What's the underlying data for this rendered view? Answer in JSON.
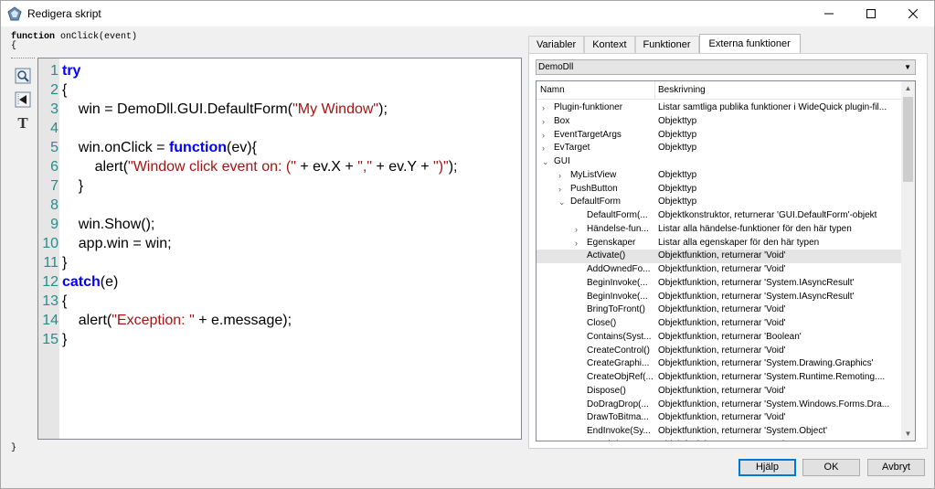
{
  "window": {
    "title": "Redigera skript",
    "minimize": "—",
    "maximize": "☐",
    "close": "✕"
  },
  "signature": {
    "keyword": "function",
    "rest": " onClick(event)",
    "open_brace": "{",
    "close_brace": "}"
  },
  "toolbar": {
    "text_tool": "T"
  },
  "code_lines": [
    {
      "n": "1",
      "parts": [
        {
          "t": "try",
          "c": "kwd"
        }
      ]
    },
    {
      "n": "2",
      "parts": [
        {
          "t": "{",
          "c": ""
        }
      ]
    },
    {
      "n": "3",
      "parts": [
        {
          "t": "    win = DemoDll.GUI.DefaultForm(",
          "c": ""
        },
        {
          "t": "\"My Window\"",
          "c": "str"
        },
        {
          "t": ");",
          "c": ""
        }
      ]
    },
    {
      "n": "4",
      "parts": []
    },
    {
      "n": "5",
      "parts": [
        {
          "t": "    win.onClick = ",
          "c": ""
        },
        {
          "t": "function",
          "c": "kwd"
        },
        {
          "t": "(ev){",
          "c": ""
        }
      ]
    },
    {
      "n": "6",
      "parts": [
        {
          "t": "        alert(",
          "c": ""
        },
        {
          "t": "\"Window click event on: (\"",
          "c": "str"
        },
        {
          "t": " + ev.X + ",
          "c": ""
        },
        {
          "t": "\",\"",
          "c": "str"
        },
        {
          "t": " + ev.Y + ",
          "c": ""
        },
        {
          "t": "\")\"",
          "c": "str"
        },
        {
          "t": ");",
          "c": ""
        }
      ]
    },
    {
      "n": "7",
      "parts": [
        {
          "t": "    }",
          "c": ""
        }
      ]
    },
    {
      "n": "8",
      "parts": []
    },
    {
      "n": "9",
      "parts": [
        {
          "t": "    win.Show();",
          "c": ""
        }
      ]
    },
    {
      "n": "10",
      "parts": [
        {
          "t": "    app.win = win;",
          "c": ""
        }
      ]
    },
    {
      "n": "11",
      "parts": [
        {
          "t": "}",
          "c": ""
        }
      ]
    },
    {
      "n": "12",
      "parts": [
        {
          "t": "catch",
          "c": "kwd"
        },
        {
          "t": "(e)",
          "c": ""
        }
      ]
    },
    {
      "n": "13",
      "parts": [
        {
          "t": "{",
          "c": ""
        }
      ]
    },
    {
      "n": "14",
      "parts": [
        {
          "t": "    alert(",
          "c": ""
        },
        {
          "t": "\"Exception: \"",
          "c": "str"
        },
        {
          "t": " + e.message);",
          "c": ""
        }
      ]
    },
    {
      "n": "15",
      "parts": [
        {
          "t": "}",
          "c": ""
        }
      ]
    }
  ],
  "tabs": [
    {
      "label": "Variabler",
      "active": false
    },
    {
      "label": "Kontext",
      "active": false
    },
    {
      "label": "Funktioner",
      "active": false
    },
    {
      "label": "Externa funktioner",
      "active": true
    }
  ],
  "dropdown": {
    "value": "DemoDll"
  },
  "listview": {
    "col_name": "Namn",
    "col_desc": "Beskrivning",
    "rows": [
      {
        "level": 0,
        "exp": "›",
        "name": "Plugin-funktioner",
        "desc": "Listar samtliga publika funktioner i WideQuick plugin-fil..."
      },
      {
        "level": 0,
        "exp": "›",
        "name": "Box",
        "desc": "Objekttyp"
      },
      {
        "level": 0,
        "exp": "›",
        "name": "EventTargetArgs",
        "desc": "Objekttyp"
      },
      {
        "level": 0,
        "exp": "›",
        "name": "EvTarget",
        "desc": "Objekttyp"
      },
      {
        "level": 0,
        "exp": "⌄",
        "name": "GUI",
        "desc": ""
      },
      {
        "level": 1,
        "exp": "›",
        "name": "MyListView",
        "desc": "Objekttyp"
      },
      {
        "level": 1,
        "exp": "›",
        "name": "PushButton",
        "desc": "Objekttyp"
      },
      {
        "level": 1,
        "exp": "⌄",
        "name": "DefaultForm",
        "desc": "Objekttyp"
      },
      {
        "level": 2,
        "exp": "",
        "name": "DefaultForm(...",
        "desc": "Objektkonstruktor, returnerar 'GUI.DefaultForm'-objekt"
      },
      {
        "level": 2,
        "exp": "›",
        "name": "Händelse-fun...",
        "desc": "Listar alla händelse-funktioner för den här typen"
      },
      {
        "level": 2,
        "exp": "›",
        "name": "Egenskaper",
        "desc": "Listar alla egenskaper för den här typen"
      },
      {
        "level": 2,
        "exp": "",
        "name": "Activate()",
        "desc": "Objektfunktion, returnerar 'Void'",
        "selected": true
      },
      {
        "level": 2,
        "exp": "",
        "name": "AddOwnedFo...",
        "desc": "Objektfunktion, returnerar 'Void'"
      },
      {
        "level": 2,
        "exp": "",
        "name": "BeginInvoke(...",
        "desc": "Objektfunktion, returnerar 'System.IAsyncResult'"
      },
      {
        "level": 2,
        "exp": "",
        "name": "BeginInvoke(...",
        "desc": "Objektfunktion, returnerar 'System.IAsyncResult'"
      },
      {
        "level": 2,
        "exp": "",
        "name": "BringToFront()",
        "desc": "Objektfunktion, returnerar 'Void'"
      },
      {
        "level": 2,
        "exp": "",
        "name": "Close()",
        "desc": "Objektfunktion, returnerar 'Void'"
      },
      {
        "level": 2,
        "exp": "",
        "name": "Contains(Syst...",
        "desc": "Objektfunktion, returnerar 'Boolean'"
      },
      {
        "level": 2,
        "exp": "",
        "name": "CreateControl()",
        "desc": "Objektfunktion, returnerar 'Void'"
      },
      {
        "level": 2,
        "exp": "",
        "name": "CreateGraphi...",
        "desc": "Objektfunktion, returnerar 'System.Drawing.Graphics'"
      },
      {
        "level": 2,
        "exp": "",
        "name": "CreateObjRef(...",
        "desc": "Objektfunktion, returnerar 'System.Runtime.Remoting...."
      },
      {
        "level": 2,
        "exp": "",
        "name": "Dispose()",
        "desc": "Objektfunktion, returnerar 'Void'"
      },
      {
        "level": 2,
        "exp": "",
        "name": "DoDragDrop(...",
        "desc": "Objektfunktion, returnerar 'System.Windows.Forms.Dra..."
      },
      {
        "level": 2,
        "exp": "",
        "name": "DrawToBitma...",
        "desc": "Objektfunktion, returnerar 'Void'"
      },
      {
        "level": 2,
        "exp": "",
        "name": "EndInvoke(Sy...",
        "desc": "Objektfunktion, returnerar 'System.Object'"
      },
      {
        "level": 2,
        "exp": "",
        "name": "Equals(Syst...",
        "desc": "Objektfunktion, returnerar 'Boolean'"
      }
    ]
  },
  "buttons": {
    "help": "Hjälp",
    "ok": "OK",
    "cancel": "Avbryt"
  }
}
